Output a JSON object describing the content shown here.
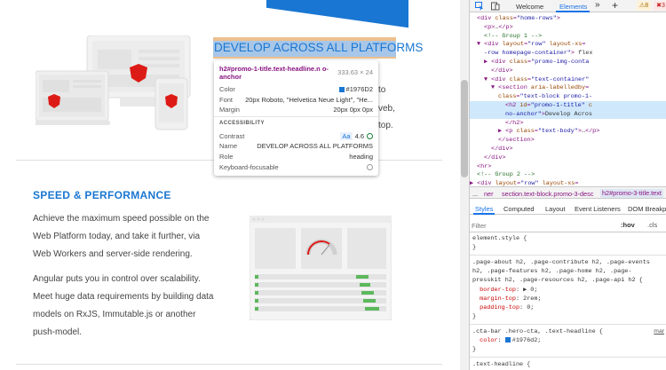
{
  "page": {
    "headline": "DEVELOP ACROSS ALL PLATFORMS",
    "cutoff_lines": [
      "to",
      "veb,",
      "top."
    ],
    "speed_title": "SPEED & PERFORMANCE",
    "para1": [
      "Achieve the maximum speed possible on the",
      "Web Platform today, and take it further, via",
      "Web Workers and server-side rendering."
    ],
    "para2": [
      "Angular puts you in control over scalability.",
      "Meet huge data requirements by building data",
      "models on RxJS, Immutable.js or another",
      "push-model."
    ],
    "colors": {
      "accent": "#1976D2",
      "angular_red": "#dd1b16",
      "highlight": "#a8c7e8"
    }
  },
  "tooltip": {
    "selector": "h2#promo-1-title.text-headline.n o-anchor",
    "size": "333.63 × 24",
    "color_label": "Color",
    "color_value": "#1976D2",
    "font_label": "Font",
    "font_value": "20px Roboto, \"Helvetica Neue Light\", \"He...",
    "margin_label": "Margin",
    "margin_value": "20px 0px 0px",
    "accessibility": "ACCESSIBILITY",
    "contrast_label": "Contrast",
    "contrast_aa": "Aa",
    "contrast_value": "4.6",
    "name_label": "Name",
    "name_value": "DEVELOP ACROSS ALL PLATFORMS",
    "role_label": "Role",
    "role_value": "heading",
    "keyboard_label": "Keyboard-focusable"
  },
  "devtools": {
    "tabs": [
      "Welcome",
      "Elements"
    ],
    "active_tab": "Elements",
    "more": "»",
    "add": "+",
    "warnings": "8",
    "errors": "3",
    "dom_lines": [
      {
        "indent": 104,
        "html": "<span class='tag'>&lt;div</span> <span class='attr'>class</span>=<span class='val'>\"home-rows\"</span><span class='tag'>&gt;</span>"
      },
      {
        "indent": 112,
        "html": "<span class='tag'>&lt;p&gt;</span><span class='txt'>…</span><span class='tag'>&lt;/p&gt;</span>"
      },
      {
        "indent": 112,
        "html": "<span class='cmt'>&lt;!-- Group 1 --&gt;</span>"
      },
      {
        "indent": 104,
        "html": "▼ <span class='tag'>&lt;div</span> <span class='attr'>layout</span>=<span class='val'>\"row\"</span> <span class='attr'>layout-xs</span>="
      },
      {
        "indent": 112,
        "html": "<span class='val'>-row homepage-container\"</span><span class='tag'>&gt;</span> <span class='txt'>flex</span>"
      },
      {
        "indent": 112,
        "html": "▶ <span class='tag'>&lt;div</span> <span class='attr'>class</span>=<span class='val'>\"promo-img-conta</span>"
      },
      {
        "indent": 120,
        "html": "<span class='tag'>&lt;/div&gt;</span>"
      },
      {
        "indent": 112,
        "html": "▼ <span class='tag'>&lt;div</span> <span class='attr'>class</span>=<span class='val'>\"text-container\"</span>"
      },
      {
        "indent": 120,
        "html": "▼ <span class='tag'>&lt;section</span> <span class='attr'>aria-labelledby</span>="
      },
      {
        "indent": 128,
        "html": "<span class='attr'>class</span>=<span class='val'>\"text-block promo-1-</span>"
      },
      {
        "indent": 136,
        "html": "<span class='tag'>&lt;h2</span> <span class='attr'>id</span>=<span class='val'>\"promo-1-title\"</span> <span class='attr'>c</span>",
        "sel": true
      },
      {
        "indent": 136,
        "html": "<span class='val'>no-anchor\"</span><span class='tag'>&gt;</span><span class='txt'>Develop Acros</span>",
        "sel": true
      },
      {
        "indent": 136,
        "html": "<span class='tag'>&lt;/h2&gt;</span>"
      },
      {
        "indent": 128,
        "html": "▶ <span class='tag'>&lt;p</span> <span class='attr'>class</span>=<span class='val'>\"text-body\"</span><span class='tag'>&gt;</span><span class='txt'>…</span><span class='tag'>&lt;/p&gt;</span>"
      },
      {
        "indent": 128,
        "html": "<span class='tag'>&lt;/section&gt;</span>"
      },
      {
        "indent": 120,
        "html": "<span class='tag'>&lt;/div&gt;</span>"
      },
      {
        "indent": 112,
        "html": "<span class='tag'>&lt;/div&gt;</span>"
      },
      {
        "indent": 104,
        "html": "<span class='tag'>&lt;hr&gt;</span>"
      },
      {
        "indent": 104,
        "html": "<span class='cmt'>&lt;!-- Group 2 --&gt;</span>"
      },
      {
        "indent": 96,
        "html": "▶ <span class='tag'>&lt;div</span> <span class='attr'>layout</span>=<span class='val'>\"row\"</span> <span class='attr'>layout-xs</span>="
      }
    ],
    "crumbs": [
      "...",
      "ner",
      "section.text-block.promo-3-desc",
      "h2#promo-3-title.text"
    ],
    "subtabs": [
      "Styles",
      "Computed",
      "Layout",
      "Event Listeners",
      "DOM Breakp"
    ],
    "filter_placeholder": "Filter",
    "hov": ":hov",
    "cls": ".cls",
    "css_lines": [
      {
        "text": "element.style {"
      },
      {
        "text": "}"
      },
      {
        "text": ".page-about h2, .page-contribute h2, .page-events"
      },
      {
        "text": "h2, .page-features h2, .page-home h2, .page-"
      },
      {
        "text": "presskit h2, .page-resources h2, .page-api h2 {"
      },
      {
        "html": "&nbsp;&nbsp;<span class='prop'>border-top</span>: ▶ 0;"
      },
      {
        "html": "&nbsp;&nbsp;<span class='prop'>margin-top</span>: 2rem;"
      },
      {
        "html": "&nbsp;&nbsp;<span class='prop'>padding-top</span>: 0;"
      },
      {
        "text": "}"
      },
      {
        "text": ".cta-bar .hero-cta, .text-headline {"
      },
      {
        "html": "&nbsp;&nbsp;<span class='prop'>color</span>: <span class='sw'></span>#1976d2;"
      },
      {
        "text": "}"
      },
      {
        "text": ".text-headline {"
      },
      {
        "html": "&nbsp;&nbsp;<s><span class='prop'>font-size</span>: 20px;</s>"
      }
    ],
    "css_source": "mar"
  }
}
